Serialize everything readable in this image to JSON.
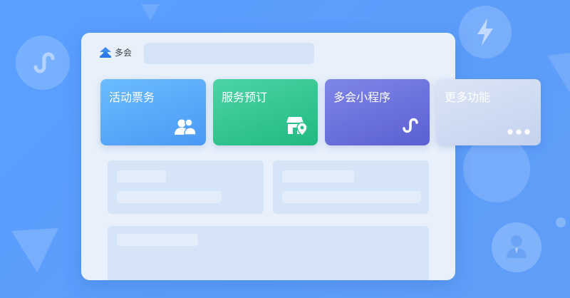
{
  "brand": {
    "name": "多会",
    "icon": "logo-icon"
  },
  "search": {
    "placeholder": ""
  },
  "cards": [
    {
      "label": "活动票务",
      "icon": "people-icon",
      "color": "#4a98f5"
    },
    {
      "label": "服务预订",
      "icon": "store-location-icon",
      "color": "#20b981"
    },
    {
      "label": "多会小程序",
      "icon": "mini-program-icon",
      "color": "#5a5fd2"
    },
    {
      "label": "更多功能",
      "icon": "more-dots-icon",
      "color": "#c4d2ee"
    }
  ],
  "colors": {
    "background": "#5a9ffc",
    "panel": "#e8f0fb",
    "skeleton": "#d5e4f6"
  },
  "background_icons": [
    "mini-program-icon",
    "lightning-icon",
    "user-icon"
  ]
}
